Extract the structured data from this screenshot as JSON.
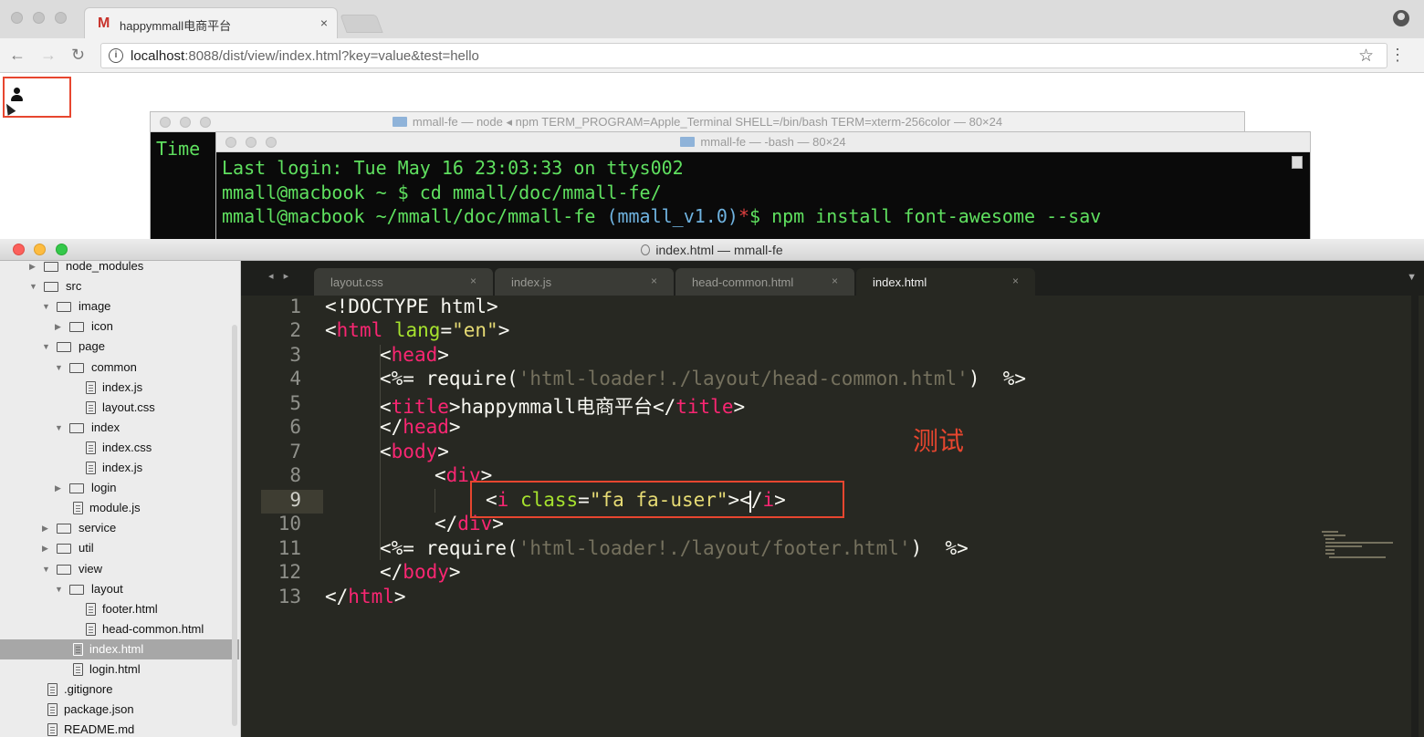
{
  "browser": {
    "tab": {
      "favicon": "M",
      "title": "happymmall电商平台",
      "close": "×"
    },
    "nav": {
      "back": "←",
      "forward": "→",
      "reload": "↻"
    },
    "info_glyph": "i",
    "url": {
      "host": "localhost",
      "rest": ":8088/dist/view/index.html?key=value&test=hello"
    },
    "star": "☆",
    "menu": "⋮"
  },
  "terminal_back": {
    "title": "mmall-fe — node ◂ npm TERM_PROGRAM=Apple_Terminal SHELL=/bin/bash TERM=xterm-256color — 80×24",
    "visible_text": "Time"
  },
  "terminal_front": {
    "title": "mmall-fe — -bash — 80×24",
    "line1": "Last login: Tue May 16 23:03:33 on ttys002",
    "line2": "mmall@macbook ~ $ cd mmall/doc/mmall-fe/",
    "line3_prefix": "mmall@macbook ~/mmall/doc/mmall-fe ",
    "line3_branch": "(mmall_v1.0)",
    "line3_star": "*",
    "line3_cmd": "$ npm install font-awesome --sav"
  },
  "editor": {
    "title": "index.html — mmall-fe",
    "tab_nav": "◂ ▸",
    "tab_dropdown": "▼",
    "tabs": [
      {
        "label": "layout.css",
        "close": "×"
      },
      {
        "label": "index.js",
        "close": "×"
      },
      {
        "label": "head-common.html",
        "close": "×"
      },
      {
        "label": "index.html",
        "close": "×"
      }
    ],
    "annotation": "测试"
  },
  "tree": [
    {
      "label": "node_modules"
    },
    {
      "label": "src"
    },
    {
      "label": "image"
    },
    {
      "label": "icon"
    },
    {
      "label": "page"
    },
    {
      "label": "common"
    },
    {
      "label": "index.js"
    },
    {
      "label": "layout.css"
    },
    {
      "label": "index"
    },
    {
      "label": "index.css"
    },
    {
      "label": "index.js"
    },
    {
      "label": "login"
    },
    {
      "label": "module.js"
    },
    {
      "label": "service"
    },
    {
      "label": "util"
    },
    {
      "label": "view"
    },
    {
      "label": "layout"
    },
    {
      "label": "footer.html"
    },
    {
      "label": "head-common.html"
    },
    {
      "label": "index.html"
    },
    {
      "label": "login.html"
    },
    {
      "label": ".gitignore"
    },
    {
      "label": "package.json"
    },
    {
      "label": "README.md"
    }
  ],
  "line_numbers": [
    "1",
    "2",
    "3",
    "4",
    "5",
    "6",
    "7",
    "8",
    "9",
    "10",
    "11",
    "12",
    "13"
  ],
  "code": {
    "l1": "<!DOCTYPE html>",
    "l2": {
      "open": "<",
      "tag": "html",
      "attr": " lang",
      "eq": "=",
      "str": "\"en\"",
      "close": ">"
    },
    "l3": {
      "open": "<",
      "tag": "head",
      "close": ">"
    },
    "l4": {
      "pre": "<%= require(",
      "str": "'html-loader!./layout/head-common.html'",
      "post": ")  %>"
    },
    "l5": {
      "open": "<",
      "tag": "title",
      "mid": ">happymmall电商平台</",
      "tag2": "title",
      "close": ">"
    },
    "l6": {
      "open": "</",
      "tag": "head",
      "close": ">"
    },
    "l7": {
      "open": "<",
      "tag": "body",
      "close": ">"
    },
    "l8": {
      "open": "<",
      "tag": "div",
      "close": ">"
    },
    "l9": {
      "open": "<",
      "tag": "i",
      "attr": " class",
      "eq": "=",
      "str": "\"fa fa-user\"",
      "mid": "></",
      "tag2": "i",
      "close": ">"
    },
    "l10": {
      "open": "</",
      "tag": "div",
      "close": ">"
    },
    "l11": {
      "pre": "<%= require(",
      "str": "'html-loader!./layout/footer.html'",
      "post": ")  %>"
    },
    "l12": {
      "open": "</",
      "tag": "body",
      "close": ">"
    },
    "l13": {
      "open": "</",
      "tag": "html",
      "close": ">"
    }
  }
}
